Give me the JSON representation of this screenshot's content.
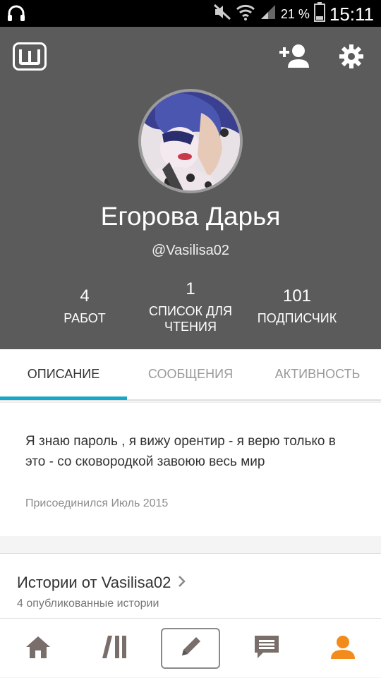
{
  "status_bar": {
    "battery_percent": "21 %",
    "time": "15:11",
    "icons": [
      "headphones-icon",
      "mute-icon",
      "wifi-icon",
      "signal-icon",
      "battery-icon"
    ]
  },
  "header": {
    "logo_icon": "wattpad-logo",
    "add_user_icon": "add-user-icon",
    "settings_icon": "gear-icon",
    "name": "Егорова Дарья",
    "handle": "@Vasilisa02",
    "stats": [
      {
        "number": "4",
        "label": "РАБОТ"
      },
      {
        "number": "1",
        "label": "СПИСОК ДЛЯ ЧТЕНИЯ"
      },
      {
        "number": "101",
        "label": "ПОДПИСЧИК"
      }
    ]
  },
  "tabs": [
    {
      "label": "ОПИСАНИЕ",
      "active": true
    },
    {
      "label": "СООБЩЕНИЯ",
      "active": false
    },
    {
      "label": "АКТИВНОСТЬ",
      "active": false
    }
  ],
  "description": {
    "text": "Я знаю пароль , я вижу орентир - я верю только в это - со сковородкой завоюю весь мир",
    "joined": "Присоединился Июль 2015"
  },
  "stories": {
    "title": "Истории от Vasilisa02",
    "subtitle": "4 опубликованные истории"
  },
  "bottom_nav": [
    {
      "icon": "home-icon"
    },
    {
      "icon": "library-icon"
    },
    {
      "icon": "pencil-icon"
    },
    {
      "icon": "messages-icon"
    },
    {
      "icon": "profile-icon"
    }
  ],
  "colors": {
    "header_bg": "#5c5b5c",
    "accent": "#17a7c8",
    "profile_active": "#f28b1c"
  }
}
